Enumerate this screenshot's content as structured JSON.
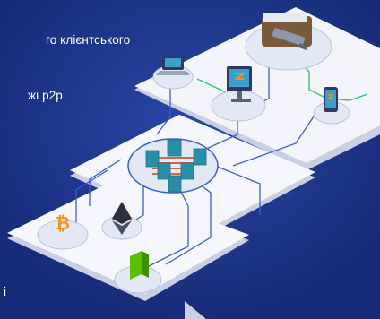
{
  "captions": {
    "line1": "го клієнтського",
    "line2": "жі p2p",
    "line3": "і"
  },
  "colors": {
    "background": "#1a3285",
    "platform": "#f3f5fb",
    "platform_edge": "#c9d0e4",
    "wire": "#3f5bd6",
    "green_wire": "#38c172",
    "server": "#2b8ea8",
    "bitcoin": "#f7931a",
    "neo": "#58bf00"
  },
  "icons": [
    "wallet-with-usb-icon",
    "laptop-icon",
    "desktop-monitor-icon",
    "smartphone-icon",
    "server-cluster-icon",
    "bitcoin-icon",
    "ethereum-icon",
    "neo-icon",
    "pointer-arrow-icon"
  ]
}
